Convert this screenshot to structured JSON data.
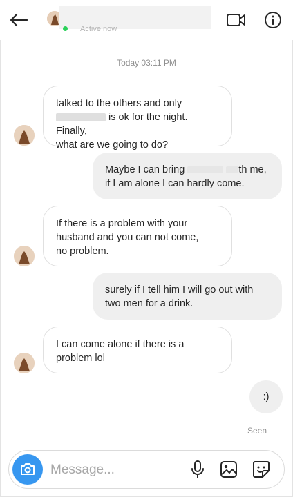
{
  "header": {
    "back_icon": "arrow-left-icon",
    "status_text": "Active now",
    "video_icon": "video-camera-icon",
    "info_icon": "info-icon"
  },
  "thread": {
    "timestamp": "Today 03:11 PM",
    "messages": [
      {
        "side": "received",
        "lines": [
          "talked to the others and only",
          "is ok for the night. Finally,",
          "what are we going to do?"
        ]
      },
      {
        "side": "sent",
        "lines": [
          "Maybe I can bring",
          "th me,",
          "if I am alone I can hardly come."
        ]
      },
      {
        "side": "received",
        "lines": [
          "If there is a problem with your",
          "husband and you can not come,",
          "no problem."
        ]
      },
      {
        "side": "sent",
        "lines": [
          "surely if I tell him I will go out with",
          "two men for a drink."
        ]
      },
      {
        "side": "received",
        "lines": [
          "I can come alone if there is a",
          "problem lol"
        ]
      },
      {
        "side": "sent",
        "lines": [
          ":)"
        ]
      }
    ],
    "seen_label": "Seen"
  },
  "composer": {
    "placeholder": "Message...",
    "camera_icon": "camera-icon",
    "mic_icon": "microphone-icon",
    "gallery_icon": "image-icon",
    "sticker_icon": "sticker-icon"
  },
  "colors": {
    "accent": "#3797f0",
    "active": "#2bd15a",
    "sent_bubble": "#efefef",
    "text": "#262626",
    "muted": "#8e8e8e"
  }
}
